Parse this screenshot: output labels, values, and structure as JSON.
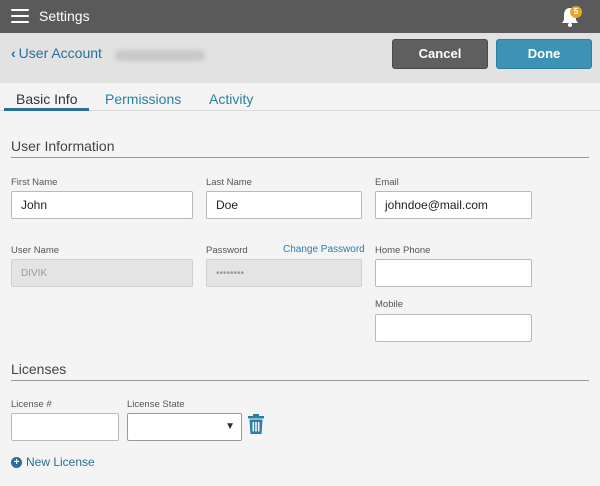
{
  "topbar": {
    "title": "Settings",
    "notification_count": "5"
  },
  "header": {
    "back_label": "User Account",
    "cancel_label": "Cancel",
    "done_label": "Done"
  },
  "tabs": [
    {
      "label": "Basic Info"
    },
    {
      "label": "Permissions"
    },
    {
      "label": "Activity"
    }
  ],
  "user_info": {
    "section_title": "User Information",
    "first_name": {
      "label": "First Name",
      "value": "John"
    },
    "last_name": {
      "label": "Last Name",
      "value": "Doe"
    },
    "email": {
      "label": "Email",
      "value": "johndoe@mail.com"
    },
    "user_name": {
      "label": "User Name",
      "value": "DIVIK"
    },
    "password": {
      "label": "Password",
      "value": "••••••••",
      "change_link": "Change Password"
    },
    "home_phone": {
      "label": "Home Phone",
      "value": ""
    },
    "mobile": {
      "label": "Mobile",
      "value": ""
    }
  },
  "licenses": {
    "section_title": "Licenses",
    "license_number": {
      "label": "License #",
      "value": ""
    },
    "license_state": {
      "label": "License State",
      "value": ""
    },
    "new_license_label": "New License"
  },
  "colors": {
    "accent": "#2a7fa5",
    "done_button": "#3d93b3",
    "topbar": "#5a5a5a",
    "badge": "#e9a72a"
  }
}
